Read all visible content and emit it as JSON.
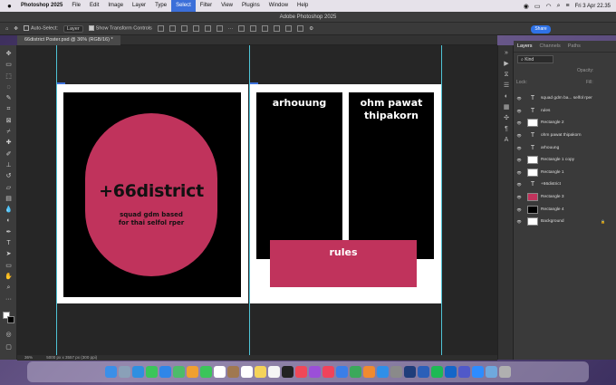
{
  "menubar": {
    "app_name": "Photoshop 2025",
    "items": [
      "File",
      "Edit",
      "Image",
      "Layer",
      "Type",
      "Select",
      "Filter",
      "View",
      "Plugins",
      "Window",
      "Help"
    ],
    "active_item": "Select",
    "clock": "Fri 3 Apr  22.35"
  },
  "window": {
    "title": "Adobe Photoshop 2025"
  },
  "options": {
    "auto_select_label": "Auto-Select:",
    "auto_select_value": "Layer",
    "transform_label": "Show Transform Controls"
  },
  "share_label": "Share",
  "document": {
    "tab_title": "66district Poster.psd @ 36% (RGB/16) *",
    "zoom": "36%",
    "dimensions": "5000 px x 3557 px (300 ppi)"
  },
  "artwork": {
    "headline": "+66district",
    "sub1": "squad gdm based",
    "sub2": "for thai selfol rper",
    "box1": "arhouung",
    "box2_line1": "ohm pawat",
    "box2_line2": "thipakorn",
    "button": "rules",
    "pink": "#c0335c"
  },
  "layers_panel": {
    "tabs": [
      "Layers",
      "Channels",
      "Paths"
    ],
    "filter_label": "Kind",
    "opacity_label": "Opacity:",
    "fill_label": "Fill:",
    "lock_label": "Lock:",
    "layers": [
      {
        "name": "squad gdm ba... selfol rper",
        "type": "text"
      },
      {
        "name": "rules",
        "type": "text"
      },
      {
        "name": "Rectangle 2",
        "type": "shape"
      },
      {
        "name": "ohm pawat  thipakorn",
        "type": "text"
      },
      {
        "name": "arhouung",
        "type": "text"
      },
      {
        "name": "Rectangle 1 copy",
        "type": "shape"
      },
      {
        "name": "Rectangle 1",
        "type": "shape"
      },
      {
        "name": "+66district",
        "type": "text"
      },
      {
        "name": "Rectangle 3",
        "type": "shape-pink"
      },
      {
        "name": "Rectangle 4",
        "type": "shape-black"
      },
      {
        "name": "Background",
        "type": "background"
      }
    ]
  },
  "tools": [
    "move",
    "artboard",
    "marquee",
    "lasso",
    "quick-select",
    "crop",
    "frame",
    "eyedropper",
    "healing",
    "brush",
    "clone",
    "history",
    "eraser",
    "gradient",
    "blur",
    "dodge",
    "pen",
    "type",
    "path-select",
    "rectangle",
    "hand",
    "zoom",
    "more"
  ],
  "dock": [
    "Finder",
    "Launchpad",
    "Safari",
    "Messages",
    "Mail",
    "Maps",
    "Photos",
    "FaceTime",
    "Calendar",
    "Contacts",
    "Reminders",
    "Notes",
    "Freeform",
    "TV",
    "Music",
    "Podcasts",
    "News",
    "Keynote",
    "Numbers",
    "Pages",
    "App Store",
    "Settings",
    "Photoshop",
    "Word",
    "Spotify",
    "Outlook",
    "Teams",
    "Zoom",
    "Preview",
    "Trash"
  ]
}
